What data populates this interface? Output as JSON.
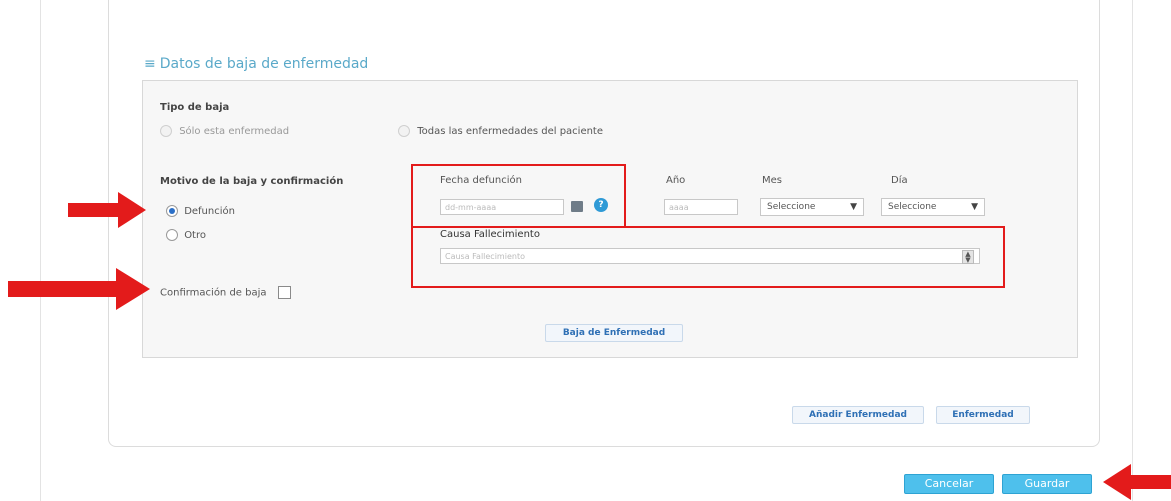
{
  "section": {
    "title": "Datos de baja de enfermedad",
    "bullet": "≡"
  },
  "tipo_baja": {
    "label": "Tipo de baja",
    "option_solo": "Sólo esta enfermedad",
    "option_todas": "Todas las enfermedades del paciente"
  },
  "motivo": {
    "label": "Motivo de la baja y confirmación",
    "option_defuncion": "Defunción",
    "option_otro": "Otro",
    "selected": "Defunción"
  },
  "confirmacion": {
    "label": "Confirmación de baja",
    "checked": false
  },
  "fecha_defuncion": {
    "label": "Fecha defunción",
    "placeholder": "dd-mm-aaaa",
    "help": "?"
  },
  "anio": {
    "label": "Año",
    "placeholder": "aaaa"
  },
  "mes": {
    "label": "Mes",
    "value": "Seleccione"
  },
  "dia": {
    "label": "Día",
    "value": "Seleccione"
  },
  "causa": {
    "label": "Causa Fallecimiento",
    "placeholder": "Causa Fallecimiento"
  },
  "buttons": {
    "baja_enfermedad": "Baja de Enfermedad",
    "anadir_enfermedad": "Añadir Enfermedad",
    "enfermedad": "Enfermedad",
    "cancelar": "Cancelar",
    "guardar": "Guardar"
  },
  "colors": {
    "annotation": "#e31b1b",
    "accent": "#4ec0ec",
    "section_title": "#5aa9c9",
    "radio_selected": "#2b6fc7"
  }
}
